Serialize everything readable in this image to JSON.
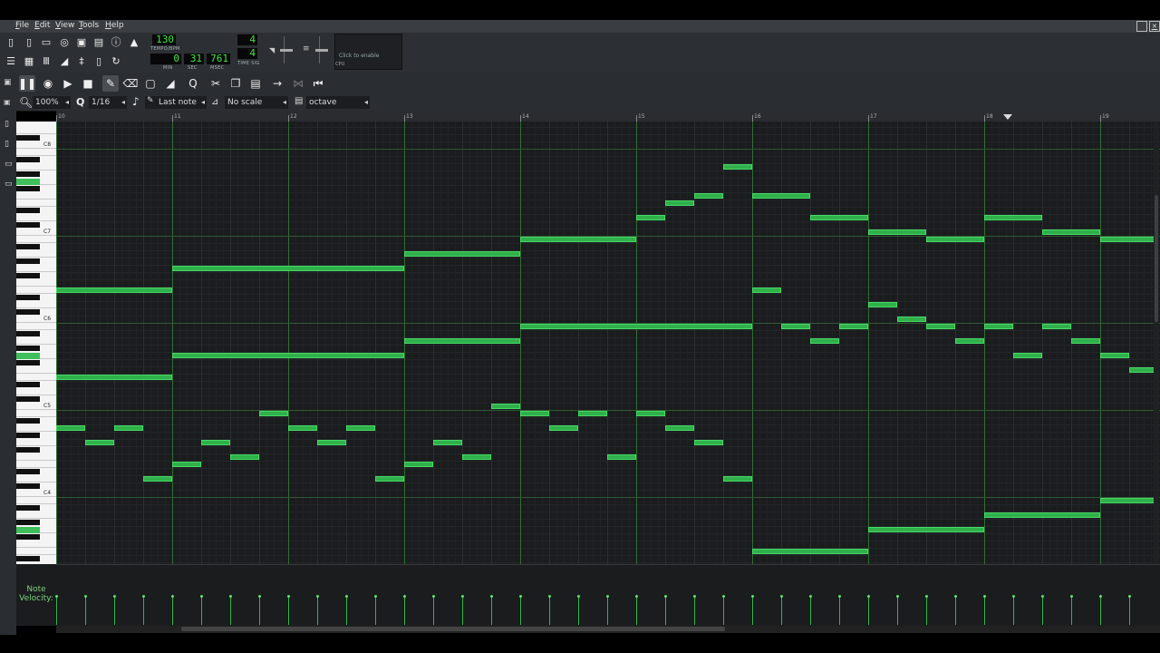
{
  "menu": [
    "File",
    "Edit",
    "View",
    "Tools",
    "Help"
  ],
  "transport": {
    "tempo": "130",
    "tempo_label": "TEMPO/BPM",
    "time_min": "0",
    "time_sec": "31",
    "time_msec": "761",
    "min_label": "MIN",
    "sec_label": "SEC",
    "msec_label": "MSEC",
    "timesig_num": "4",
    "timesig_den": "4",
    "timesig_label": "TIME SIG",
    "cpu_text": "Click to enable",
    "cpu_label": "CPU"
  },
  "piano_roll": {
    "zoom": "100%",
    "quantize": "1/16",
    "note_length": "Last note",
    "scale": "No scale",
    "chord": "octave",
    "bars": [
      "10",
      "11",
      "12",
      "13",
      "14",
      "15",
      "16",
      "17",
      "18",
      "19"
    ],
    "velocity_label_1": "Note",
    "velocity_label_2": "Velocity:",
    "c_labels": [
      "C8",
      "C7",
      "C6",
      "C5",
      "C4"
    ]
  },
  "colors": {
    "note": "#2fb04a",
    "grid_bar": "#2f6e32",
    "lcd_text": "#3fe83a"
  },
  "notes": [
    {
      "bar": 10,
      "start": 0,
      "len": 4,
      "pitch": "E6"
    },
    {
      "bar": 10,
      "start": 0,
      "len": 4,
      "pitch": "E5"
    },
    {
      "bar": 10,
      "start": 0,
      "len": 1,
      "pitch": "A4"
    },
    {
      "bar": 10,
      "start": 1,
      "len": 1,
      "pitch": "G4"
    },
    {
      "bar": 10,
      "start": 2,
      "len": 1,
      "pitch": "A4"
    },
    {
      "bar": 10,
      "start": 3,
      "len": 1,
      "pitch": "D4"
    },
    {
      "bar": 11,
      "start": 0,
      "len": 8,
      "pitch": "G6"
    },
    {
      "bar": 11,
      "start": 0,
      "len": 8,
      "pitch": "G5"
    },
    {
      "bar": 11,
      "start": 0,
      "len": 1,
      "pitch": "E4"
    },
    {
      "bar": 11,
      "start": 1,
      "len": 1,
      "pitch": "G4"
    },
    {
      "bar": 11,
      "start": 2,
      "len": 1,
      "pitch": "F4"
    },
    {
      "bar": 11,
      "start": 3,
      "len": 1,
      "pitch": "B4"
    },
    {
      "bar": 12,
      "start": 0,
      "len": 1,
      "pitch": "A4"
    },
    {
      "bar": 12,
      "start": 1,
      "len": 1,
      "pitch": "G4"
    },
    {
      "bar": 12,
      "start": 2,
      "len": 1,
      "pitch": "A4"
    },
    {
      "bar": 12,
      "start": 3,
      "len": 1,
      "pitch": "D4"
    },
    {
      "bar": 13,
      "start": 0,
      "len": 4,
      "pitch": "A6"
    },
    {
      "bar": 13,
      "start": 0,
      "len": 4,
      "pitch": "A5"
    },
    {
      "bar": 13,
      "start": 0,
      "len": 1,
      "pitch": "E4"
    },
    {
      "bar": 13,
      "start": 1,
      "len": 1,
      "pitch": "G4"
    },
    {
      "bar": 13,
      "start": 2,
      "len": 1,
      "pitch": "F4"
    },
    {
      "bar": 13,
      "start": 3,
      "len": 1,
      "pitch": "C5"
    },
    {
      "bar": 14,
      "start": 0,
      "len": 4,
      "pitch": "B6"
    },
    {
      "bar": 14,
      "start": 0,
      "len": 8,
      "pitch": "B5"
    },
    {
      "bar": 14,
      "start": 0,
      "len": 1,
      "pitch": "B4"
    },
    {
      "bar": 14,
      "start": 1,
      "len": 1,
      "pitch": "A4"
    },
    {
      "bar": 14,
      "start": 2,
      "len": 1,
      "pitch": "B4"
    },
    {
      "bar": 14,
      "start": 3,
      "len": 1,
      "pitch": "F4"
    },
    {
      "bar": 15,
      "start": 0,
      "len": 1,
      "pitch": "D7"
    },
    {
      "bar": 15,
      "start": 1,
      "len": 1,
      "pitch": "E7"
    },
    {
      "bar": 15,
      "start": 2,
      "len": 1,
      "pitch": "F7"
    },
    {
      "bar": 15,
      "start": 3,
      "len": 1,
      "pitch": "A7"
    },
    {
      "bar": 15,
      "start": 0,
      "len": 1,
      "pitch": "B4"
    },
    {
      "bar": 15,
      "start": 1,
      "len": 1,
      "pitch": "A4"
    },
    {
      "bar": 15,
      "start": 2,
      "len": 1,
      "pitch": "G4"
    },
    {
      "bar": 15,
      "start": 3,
      "len": 1,
      "pitch": "D4"
    },
    {
      "bar": 16,
      "start": 0,
      "len": 2,
      "pitch": "F7"
    },
    {
      "bar": 16,
      "start": 2,
      "len": 2,
      "pitch": "D7"
    },
    {
      "bar": 16,
      "start": 0,
      "len": 1,
      "pitch": "E6"
    },
    {
      "bar": 16,
      "start": 1,
      "len": 1,
      "pitch": "B5"
    },
    {
      "bar": 16,
      "start": 2,
      "len": 1,
      "pitch": "A5"
    },
    {
      "bar": 16,
      "start": 3,
      "len": 1,
      "pitch": "B5"
    },
    {
      "bar": 16,
      "start": 0,
      "len": 4,
      "pitch": "E3"
    },
    {
      "bar": 17,
      "start": 0,
      "len": 2,
      "pitch": "C7"
    },
    {
      "bar": 17,
      "start": 2,
      "len": 2,
      "pitch": "B6"
    },
    {
      "bar": 17,
      "start": 0,
      "len": 1,
      "pitch": "D6"
    },
    {
      "bar": 17,
      "start": 1,
      "len": 1,
      "pitch": "C6"
    },
    {
      "bar": 17,
      "start": 2,
      "len": 1,
      "pitch": "B5"
    },
    {
      "bar": 17,
      "start": 3,
      "len": 1,
      "pitch": "A5"
    },
    {
      "bar": 17,
      "start": 0,
      "len": 4,
      "pitch": "G3"
    },
    {
      "bar": 18,
      "start": 0,
      "len": 2,
      "pitch": "D7"
    },
    {
      "bar": 18,
      "start": 2,
      "len": 2,
      "pitch": "C7"
    },
    {
      "bar": 18,
      "start": 0,
      "len": 1,
      "pitch": "B5"
    },
    {
      "bar": 18,
      "start": 1,
      "len": 1,
      "pitch": "G5"
    },
    {
      "bar": 18,
      "start": 2,
      "len": 1,
      "pitch": "B5"
    },
    {
      "bar": 18,
      "start": 3,
      "len": 1,
      "pitch": "A5"
    },
    {
      "bar": 18,
      "start": 0,
      "len": 4,
      "pitch": "A3"
    },
    {
      "bar": 19,
      "start": 0,
      "len": 2,
      "pitch": "B6"
    },
    {
      "bar": 19,
      "start": 0,
      "len": 1,
      "pitch": "G5"
    },
    {
      "bar": 19,
      "start": 1,
      "len": 1,
      "pitch": "F5"
    },
    {
      "bar": 19,
      "start": 0,
      "len": 2,
      "pitch": "B3"
    }
  ]
}
